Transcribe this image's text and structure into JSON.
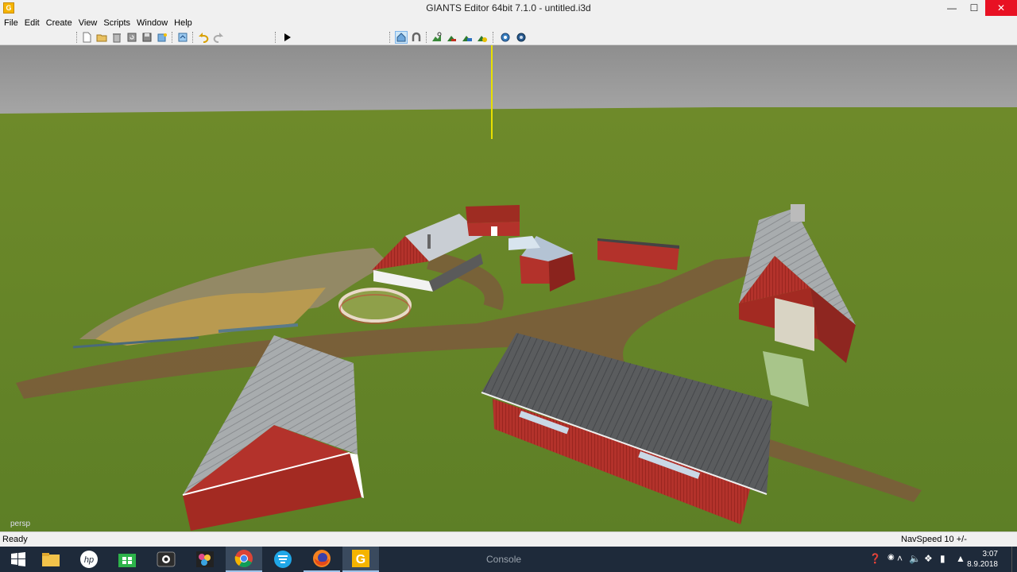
{
  "window": {
    "title": "GIANTS Editor 64bit 7.1.0 - untitled.i3d",
    "controls": [
      "minimize",
      "maximize",
      "close"
    ]
  },
  "menu": [
    "File",
    "Edit",
    "Create",
    "View",
    "Scripts",
    "Window",
    "Help"
  ],
  "toolbar": {
    "groups": [
      [
        "new-file-icon",
        "open-file-icon",
        "delete-icon",
        "reload-icon",
        "save-icon",
        "save-as-icon"
      ],
      [
        "import-icon"
      ],
      [
        "undo-icon",
        "redo-icon"
      ],
      [
        "play-icon"
      ],
      [
        "select-mode-icon",
        "magnet-icon"
      ],
      [
        "paint-terrain-icon",
        "sculpt-terrain-icon",
        "paint-foliage-icon",
        "place-object-icon"
      ],
      [
        "global-settings-icon",
        "local-settings-icon"
      ]
    ]
  },
  "viewport": {
    "camera_label": "persp",
    "sky_color": "#9b9b9b",
    "ground_color": "#6d8d2b",
    "path_color": "#7a5d3c"
  },
  "status": {
    "left": "Ready",
    "navspeed": "NavSpeed 10 +/-"
  },
  "taskbar": {
    "items": [
      "start-icon",
      "file-explorer-icon",
      "hp-icon",
      "store-icon",
      "camera-icon",
      "photos-icon",
      "chrome-icon",
      "vpn-icon",
      "firefox-icon",
      "giants-editor-icon"
    ],
    "console_label": "Console",
    "tray": [
      "help-icon",
      "network-icon",
      "show-hidden-icons",
      "volume-icon",
      "dropbox-icon",
      "battery-icon",
      "signal-icon"
    ],
    "time": "3:07",
    "date": "8.9.2018"
  }
}
